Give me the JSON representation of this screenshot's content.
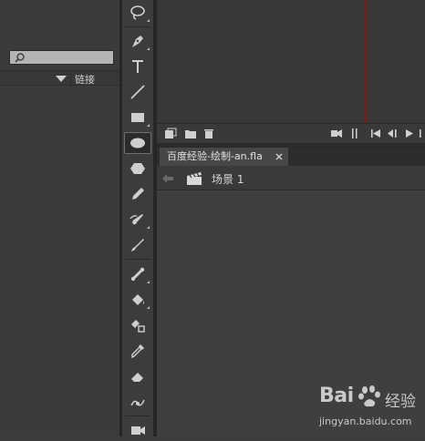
{
  "library": {
    "search_placeholder": "",
    "column_linkage": "链接"
  },
  "toolbar": {
    "tools": [
      {
        "name": "lasso-tool",
        "icon": "lasso-icon",
        "active": false
      },
      {
        "name": "pen-tool",
        "icon": "pen-icon",
        "active": false
      },
      {
        "name": "text-tool",
        "icon": "text-icon",
        "active": false
      },
      {
        "name": "line-tool",
        "icon": "line-icon",
        "active": false
      },
      {
        "name": "rectangle-tool",
        "icon": "rectangle-icon",
        "active": false
      },
      {
        "name": "oval-tool",
        "icon": "oval-icon",
        "active": true
      },
      {
        "name": "polystar-tool",
        "icon": "polystar-icon",
        "active": false
      },
      {
        "name": "pencil-tool",
        "icon": "pencil-icon",
        "active": false
      },
      {
        "name": "paint-brush-tool",
        "icon": "paint-brush-icon",
        "active": false
      },
      {
        "name": "brush-tool",
        "icon": "brush-icon",
        "active": false
      },
      {
        "name": "bone-tool",
        "icon": "bone-icon",
        "active": false
      },
      {
        "name": "paint-bucket-tool",
        "icon": "paint-bucket-icon",
        "active": false
      },
      {
        "name": "ink-bottle-tool",
        "icon": "ink-bottle-icon",
        "active": false
      },
      {
        "name": "eyedropper-tool",
        "icon": "eyedropper-icon",
        "active": false
      },
      {
        "name": "eraser-tool",
        "icon": "eraser-icon",
        "active": false
      },
      {
        "name": "width-tool",
        "icon": "width-icon",
        "active": false
      },
      {
        "name": "camera-tool",
        "icon": "camera-icon",
        "active": false
      }
    ]
  },
  "document": {
    "tab_title": "百度经验-绘制-an.fla"
  },
  "edit_bar": {
    "scene_label": "场景 1"
  },
  "watermark": {
    "logo": "Bai",
    "text": "经验",
    "url": "jingyan.baidu.com"
  },
  "colors": {
    "panel_bg": "#3c3c3c",
    "active_tool_bg": "#2b2b2b",
    "playhead": "#7a1f1f",
    "search_bg": "#b4b4b4"
  }
}
